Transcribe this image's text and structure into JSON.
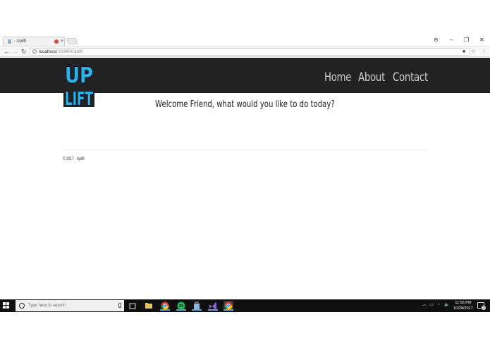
{
  "browser": {
    "tab_title": "- Uplift",
    "tab_close": "×",
    "url_host": "localhost",
    "url_path": ":50349/Uplift",
    "window_controls": [
      "⊖",
      "–",
      "❐",
      "✕"
    ],
    "nav_icons": [
      "back-icon",
      "forward-icon",
      "reload-icon"
    ]
  },
  "site": {
    "logo_top": "UP",
    "logo_bottom": "LIFT",
    "nav": {
      "home": "Home",
      "about": "About",
      "contact": "Contact"
    },
    "welcome": "Welcome Friend, what would you like to do today?",
    "footer": "© 2017 - Uplift"
  },
  "taskbar": {
    "search_placeholder": "Type here to search",
    "time": "11:56 PM",
    "date": "10/28/2017",
    "notification_count": "2",
    "apps": [
      "task-view-icon",
      "file-explorer-icon",
      "chrome-icon",
      "spotify-icon",
      "store-icon",
      "visual-studio-icon",
      "chrome-icon"
    ]
  },
  "colors": {
    "navbar": "#222222",
    "logo_fill": "#2bb3e8",
    "logo_outline": "#0b0b25",
    "nav_text": "#cfcfcf"
  }
}
